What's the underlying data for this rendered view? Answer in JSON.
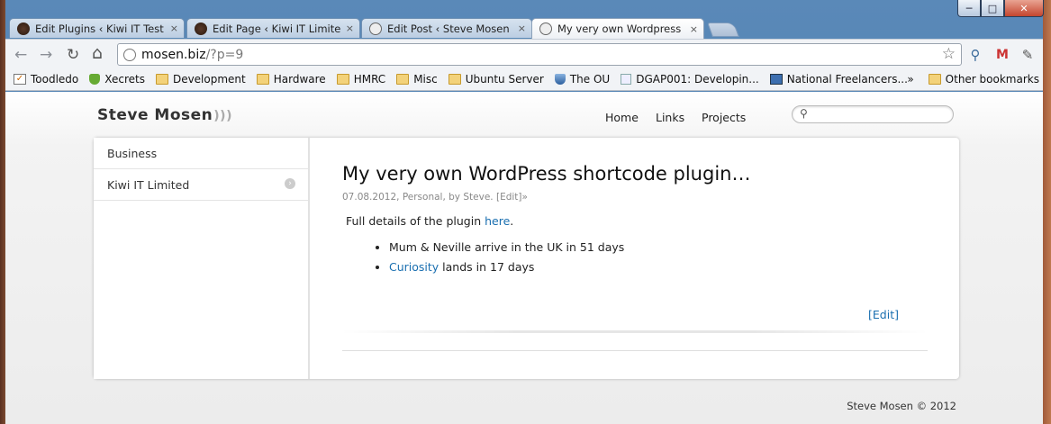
{
  "window": {
    "controls": {
      "minimize": "─",
      "maximize": "□",
      "close": "✕"
    }
  },
  "tabs": [
    {
      "title": "Edit Plugins ‹ Kiwi IT Test S",
      "icon": "kiwi-favicon",
      "close": "×",
      "active": false
    },
    {
      "title": "Edit Page ‹ Kiwi IT Limited",
      "icon": "kiwi-favicon",
      "close": "×",
      "active": false
    },
    {
      "title": "Edit Post ‹ Steve Mosen —",
      "icon": "globe-icon",
      "close": "×",
      "active": false
    },
    {
      "title": "My very own Wordpress sh",
      "icon": "globe-icon",
      "close": "×",
      "active": true
    }
  ],
  "toolbar": {
    "back": "←",
    "forward": "→",
    "reload": "↻",
    "home": "⌂",
    "url_host": "mosen.biz",
    "url_path": "/?p=9",
    "star": "☆",
    "extensions": [
      {
        "name": "key-extension-icon",
        "glyph": "🔍"
      },
      {
        "name": "gmail-icon",
        "glyph": "M"
      },
      {
        "name": "wrench-icon",
        "glyph": "🔧"
      }
    ]
  },
  "bookmarks": {
    "items": [
      {
        "label": "Toodledo",
        "icon": "checkbox-icon"
      },
      {
        "label": "Xecrets",
        "icon": "shield-icon"
      },
      {
        "label": "Development",
        "icon": "folder-icon"
      },
      {
        "label": "Hardware",
        "icon": "folder-icon"
      },
      {
        "label": "HMRC",
        "icon": "folder-icon"
      },
      {
        "label": "Misc",
        "icon": "folder-icon"
      },
      {
        "label": "Ubuntu Server",
        "icon": "folder-icon"
      },
      {
        "label": "The OU",
        "icon": "ou-shield-icon"
      },
      {
        "label": "DGAP001: Developin...",
        "icon": "page-icon"
      },
      {
        "label": "National Freelancers...",
        "icon": "nf-icon"
      }
    ],
    "overflow": "»",
    "other": "Other bookmarks"
  },
  "site": {
    "logo": "Steve Mosen",
    "rss": "))",
    "nav": [
      "Home",
      "Links",
      "Projects"
    ],
    "search_placeholder": ""
  },
  "sidebar": {
    "items": [
      {
        "label": "Business",
        "arrow": false
      },
      {
        "label": "Kiwi IT Limited",
        "arrow": true
      }
    ]
  },
  "post": {
    "title": "My very own WordPress shortcode plugin…",
    "date": "07.08.2012",
    "category": "Personal",
    "by": "by Steve.",
    "edit_meta": "[Edit]»",
    "body_prefix": "Full details of the plugin ",
    "body_link": "here",
    "body_suffix": ".",
    "list": [
      {
        "prefix": "",
        "link": "",
        "text": "Mum & Neville arrive in the UK in 51 days"
      },
      {
        "prefix": "",
        "link": "Curiosity",
        "text": " lands in 17 days"
      }
    ],
    "edit_bottom": "Edit"
  },
  "footer": {
    "text": "Steve Mosen © 2012"
  },
  "colors": {
    "link": "#1a6fb0",
    "frame": "#5a89b8"
  }
}
